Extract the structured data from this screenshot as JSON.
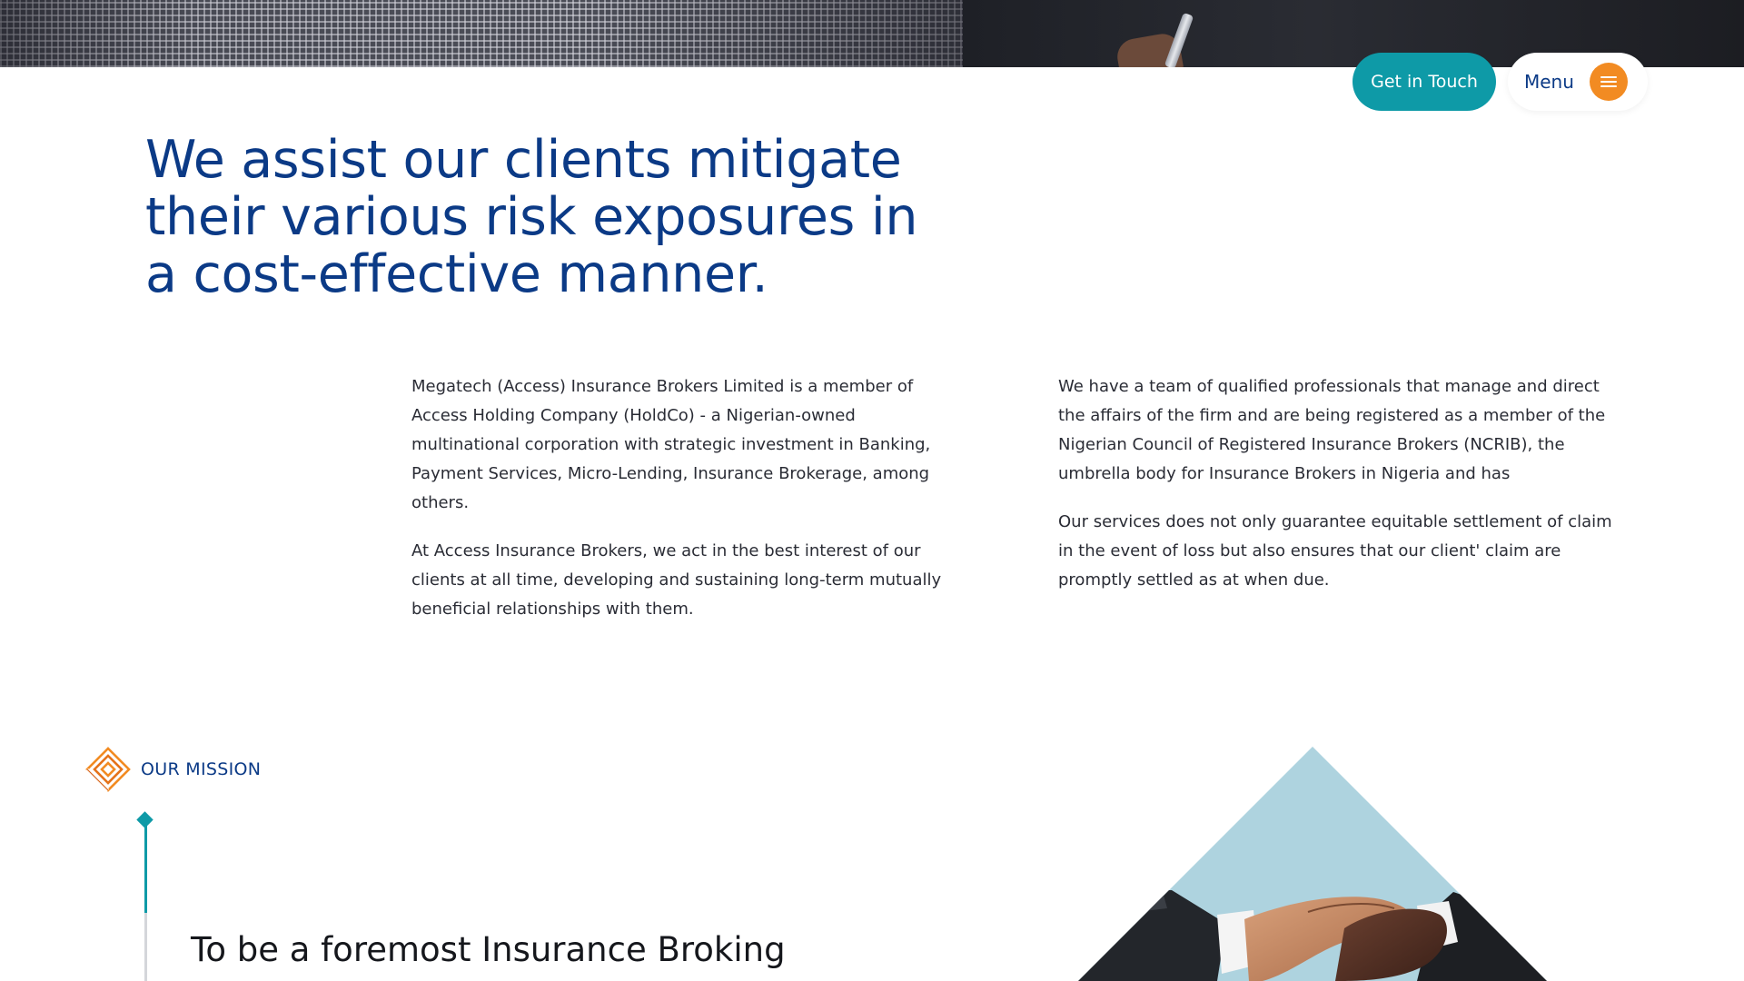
{
  "header": {
    "get_in_touch_label": "Get in Touch",
    "menu_label": "Menu",
    "menu_icon": "hamburger-icon"
  },
  "colors": {
    "brand_blue": "#0b3a86",
    "teal": "#0e9aa7",
    "orange": "#f28b22",
    "light_blue": "#aed3df"
  },
  "hero": {
    "headline": "We assist our clients mitigate their various risk exposures in a cost-effective manner."
  },
  "about": {
    "left_paragraphs": [
      "Megatech (Access) Insurance Brokers Limited is a member of Access Holding Company (HoldCo) - a Nigerian-owned multinational corporation with strategic investment in Banking, Payment Services, Micro-Lending, Insurance Brokerage, among others.",
      "At Access Insurance Brokers, we act in the best interest of our clients at all time, developing and sustaining long-term mutually beneficial relationships with them."
    ],
    "right_paragraphs": [
      "We have a team of qualified professionals that manage and direct the affairs of the firm and are being registered as a member of the Nigerian Council of Registered Insurance Brokers (NCRIB), the umbrella body for Insurance Brokers in Nigeria and has",
      "Our services does not only guarantee equitable settlement of claim in the event of loss but also ensures that our client' claim are promptly settled as at when due."
    ]
  },
  "mission": {
    "section_label": "OUR MISSION",
    "section_icon": "diamond-logo-icon",
    "statement": "To be a foremost Insurance Broking"
  }
}
